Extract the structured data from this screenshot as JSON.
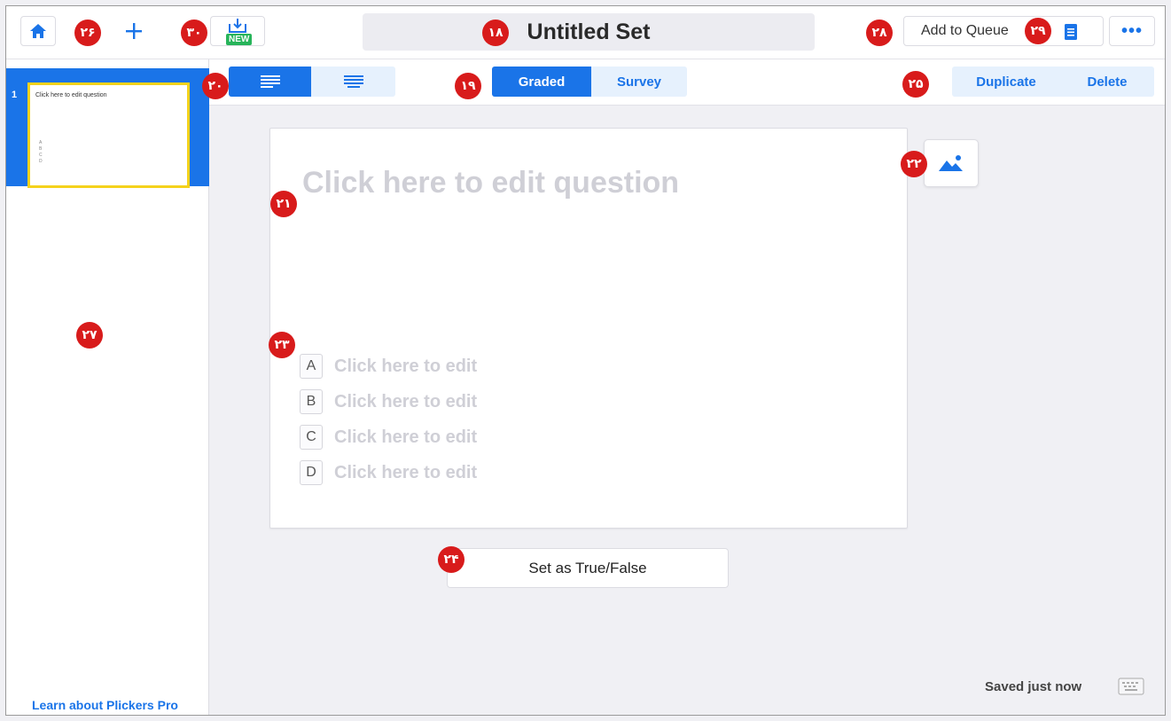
{
  "topbar": {
    "title": "Untitled Set",
    "new_tag": "NEW",
    "add_to_queue": "Add to Queue",
    "more": "•••"
  },
  "toolbar": {
    "graded": "Graded",
    "survey": "Survey",
    "duplicate": "Duplicate",
    "delete": "Delete"
  },
  "sidebar": {
    "slides": [
      {
        "number": "1",
        "question": "Click here to edit question",
        "answers": [
          "A",
          "B",
          "C",
          "D"
        ]
      }
    ],
    "learn_link": "Learn about Plickers Pro"
  },
  "question": {
    "text": "Click here to edit question",
    "answers": [
      {
        "letter": "A",
        "text": "Click here to edit"
      },
      {
        "letter": "B",
        "text": "Click here to edit"
      },
      {
        "letter": "C",
        "text": "Click here to edit"
      },
      {
        "letter": "D",
        "text": "Click here to edit"
      }
    ],
    "true_false_button": "Set as True/False"
  },
  "status": {
    "saved": "Saved just now"
  },
  "markers": {
    "m18": "۱۸",
    "m19": "۱۹",
    "m20": "۲۰",
    "m21": "۲۱",
    "m22": "۲۲",
    "m23": "۲۳",
    "m24": "۲۴",
    "m25": "۲۵",
    "m26": "۲۶",
    "m27": "۲۷",
    "m28": "۲۸",
    "m29": "۲۹",
    "m30": "۳۰"
  },
  "colors": {
    "accent": "#1a74e8",
    "accent_light": "#e6f1fd",
    "marker": "#d81b1b",
    "selected_thumb_border": "#f5d21c",
    "new_tag": "#27b45a"
  },
  "icons": [
    "home-icon",
    "plus-icon",
    "import-icon",
    "document-icon",
    "more-icon",
    "align-left-icon",
    "align-center-icon",
    "image-icon",
    "keyboard-icon"
  ]
}
